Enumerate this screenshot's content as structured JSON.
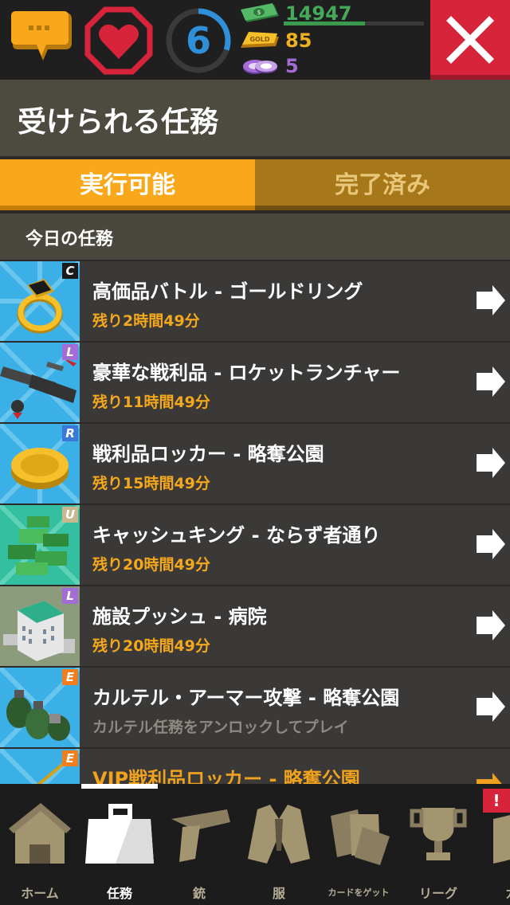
{
  "hud": {
    "cash": "14947",
    "cash_progress": 0.58,
    "gold": "85",
    "chips": "5",
    "level": "6",
    "level_progress": 0.3,
    "colors": {
      "heart": "#d8243a",
      "level": "#2f8fd8",
      "cash": "#45a95a",
      "gold": "#f0b020",
      "chips": "#a36cd6",
      "close": "#d8243a"
    }
  },
  "title": "受けられる任務",
  "tabs": [
    {
      "label": "実行可能",
      "active": true
    },
    {
      "label": "完了済み",
      "active": false
    }
  ],
  "section": {
    "title": "今日の任務"
  },
  "missions": [
    {
      "name": "高価品バトル - ゴールドリング",
      "time": "残り2時間49分",
      "rarity": "C",
      "rarity_color": "#1a1a1a",
      "icon": "gold-ring-icon",
      "thumb_bg": "#3bb0e6"
    },
    {
      "name": "豪華な戦利品 - ロケットランチャー",
      "time": "残り11時間49分",
      "rarity": "L",
      "rarity_color": "#a36cd6",
      "icon": "rocket-launcher-icon",
      "thumb_bg": "#3bb0e6"
    },
    {
      "name": "戦利品ロッカー - 略奪公園",
      "time": "残り15時間49分",
      "rarity": "R",
      "rarity_color": "#3a78d6",
      "icon": "gold-coin-icon",
      "thumb_bg": "#3bb0e6"
    },
    {
      "name": "キャッシュキング - ならず者通り",
      "time": "残り20時間49分",
      "rarity": "U",
      "rarity_color": "#c9b88e",
      "icon": "cash-pile-icon",
      "thumb_bg": "#34bfa0"
    },
    {
      "name": "施設プッシュ - 病院",
      "time": "残り20時間49分",
      "rarity": "L",
      "rarity_color": "#a36cd6",
      "icon": "hospital-building-icon",
      "thumb_bg": "#7c8f6a"
    },
    {
      "name": "カルテル・アーマー攻撃 - 略奪公園",
      "time": "カルテル任務をアンロックしてプレイ",
      "rarity": "E",
      "rarity_color": "#f07d1e",
      "icon": "grenades-icon",
      "thumb_bg": "#3bb0e6",
      "locked": true
    },
    {
      "name": "VIP戦利品ロッカー - 略奪公園",
      "time": "",
      "rarity": "E",
      "rarity_color": "#f07d1e",
      "icon": "locker-icon",
      "thumb_bg": "#3bb0e6",
      "partial": true
    }
  ],
  "nav": [
    {
      "label": "ホーム",
      "icon": "house-icon",
      "active": false
    },
    {
      "label": "任務",
      "icon": "briefcase-icon",
      "active": true
    },
    {
      "label": "銃",
      "icon": "pistol-icon",
      "active": false
    },
    {
      "label": "服",
      "icon": "suit-jacket-icon",
      "active": false
    },
    {
      "label": "カードをゲット",
      "icon": "cards-icon",
      "active": false
    },
    {
      "label": "リーグ",
      "icon": "trophy-icon",
      "active": false
    },
    {
      "label": "カル",
      "icon": "cartel-icon",
      "active": false
    }
  ],
  "alert_badge": "!"
}
